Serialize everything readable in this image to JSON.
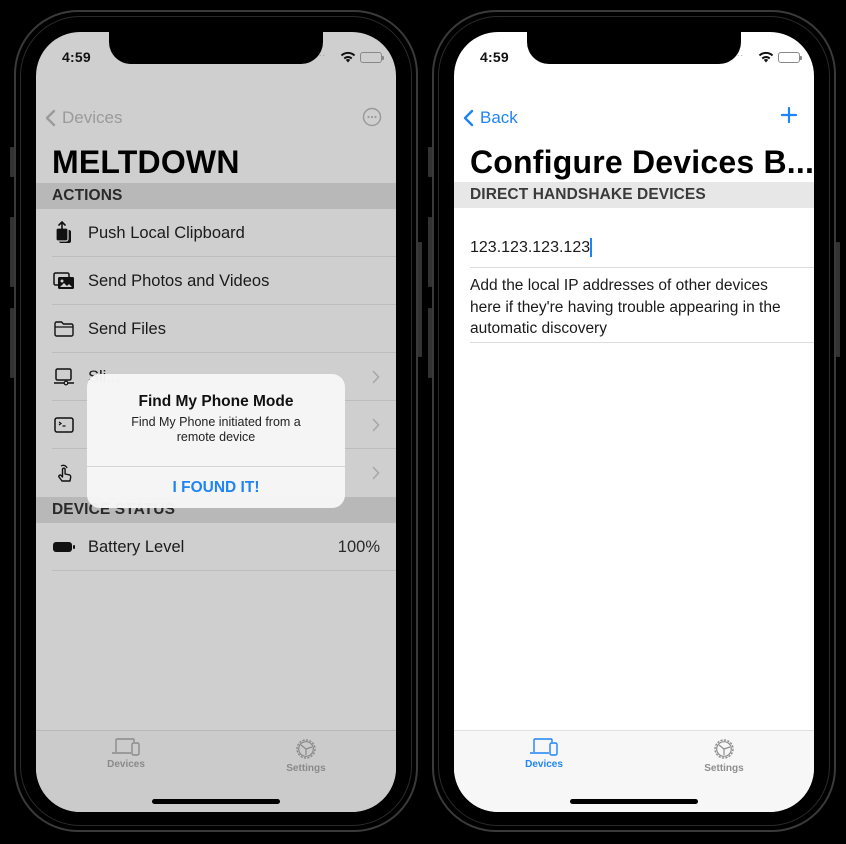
{
  "left_phone": {
    "status_bar": {
      "time": "4:59",
      "signal": "....",
      "wifi_icon": "wifi-icon",
      "battery_icon": "battery-full-icon"
    },
    "navbar": {
      "back_label": "Devices",
      "back_icon": "chevron-left-icon",
      "more_icon": "ellipsis-circle-icon"
    },
    "title": "MELTDOWN",
    "sections": {
      "actions": {
        "header": "ACTIONS",
        "items": [
          {
            "label": "Push Local Clipboard",
            "icon": "clipboard-upload-icon",
            "disclosure": false
          },
          {
            "label": "Send Photos and Videos",
            "icon": "photos-icon",
            "disclosure": false
          },
          {
            "label": "Send Files",
            "icon": "folder-icon",
            "disclosure": false
          },
          {
            "label": "Sli...",
            "icon": "desktop-slider-icon",
            "disclosure": true
          },
          {
            "label": "",
            "icon": "terminal-icon",
            "disclosure": true
          },
          {
            "label": "",
            "icon": "hand-tap-icon",
            "disclosure": true
          }
        ]
      },
      "device_status": {
        "header": "DEVICE STATUS",
        "items": [
          {
            "label": "Battery Level",
            "value": "100%",
            "icon": "battery-icon"
          }
        ]
      }
    },
    "alert": {
      "title": "Find My Phone Mode",
      "message": "Find My Phone initiated from a remote device",
      "action": "I FOUND IT!"
    },
    "tabbar": {
      "tabs": [
        {
          "label": "Devices",
          "icon": "devices-icon",
          "selected": false
        },
        {
          "label": "Settings",
          "icon": "settings-gear-icon",
          "selected": false
        }
      ]
    }
  },
  "right_phone": {
    "status_bar": {
      "time": "4:59",
      "signal": "....",
      "wifi_icon": "wifi-icon",
      "battery_icon": "battery-full-icon"
    },
    "navbar": {
      "back_label": "Back",
      "back_icon": "chevron-left-icon",
      "add_icon": "plus-icon"
    },
    "title": "Configure Devices B...",
    "section": {
      "header": "DIRECT HANDSHAKE DEVICES",
      "ip_value": "123.123.123.123",
      "help_text": "Add the local IP addresses of other devices here if they're having trouble appearing in the automatic discovery"
    },
    "tabbar": {
      "tabs": [
        {
          "label": "Devices",
          "icon": "devices-icon",
          "selected": true
        },
        {
          "label": "Settings",
          "icon": "settings-gear-icon",
          "selected": false
        }
      ]
    }
  },
  "colors": {
    "accent": "#1f84f5",
    "dimmed_background": "#cfcfcf",
    "section_header_dimmed": "#b8b8b8",
    "section_header": "#e7e7e7"
  }
}
